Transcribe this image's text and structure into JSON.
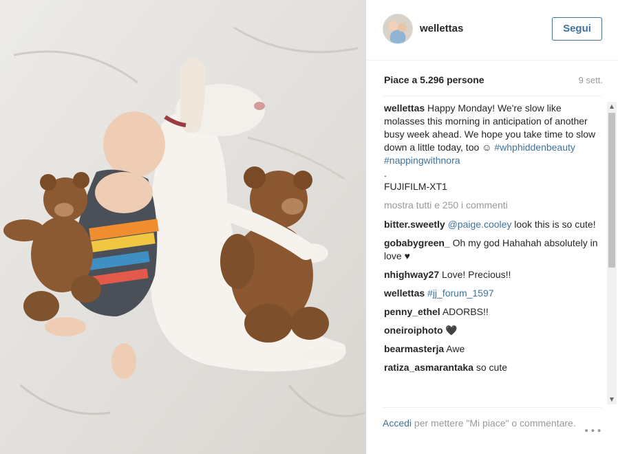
{
  "post": {
    "username": "wellettas",
    "follow_label": "Segui",
    "likes_text": "Piace a 5.296 persone",
    "date": "9 sett."
  },
  "caption": {
    "user": "wellettas",
    "text": " Happy Monday! We're slow like molasses this morning in anticipation of another busy week ahead. We hope you take time to slow down a little today, too ☺ ",
    "hashtags": "#whphiddenbeauty #nappingwithnora",
    "dot": ".",
    "camera": "FUJIFILM-XT1"
  },
  "see_all_comments": "mostra tutti e 250 i commenti",
  "comments": [
    {
      "user": "bitter.sweetly",
      "mention": "@paige.cooley",
      "text": " look this is so cute!"
    },
    {
      "user": "gobabygreen_",
      "text": " Oh my god Hahahah absolutely in love ♥"
    },
    {
      "user": "nhighway27",
      "text": " Love! Precious!!"
    },
    {
      "user": "wellettas",
      "tag": "#jj_forum_1597"
    },
    {
      "user": "penny_ethel",
      "text": " ADORBS!!"
    },
    {
      "user": "oneiroiphoto",
      "text": " 🖤"
    },
    {
      "user": "bearmasterja",
      "text": " Awe"
    },
    {
      "user": "ratiza_asmarantaka",
      "text": " so cute"
    }
  ],
  "footer": {
    "login_label": "Accedi",
    "rest": " per mettere \"Mi piace\" o commentare."
  },
  "icons": {
    "more": "more-options-icon",
    "scroll_up": "scroll-up-icon",
    "scroll_down": "scroll-down-icon"
  },
  "colors": {
    "link": "#3f729b",
    "muted": "#999999",
    "text": "#262626"
  }
}
